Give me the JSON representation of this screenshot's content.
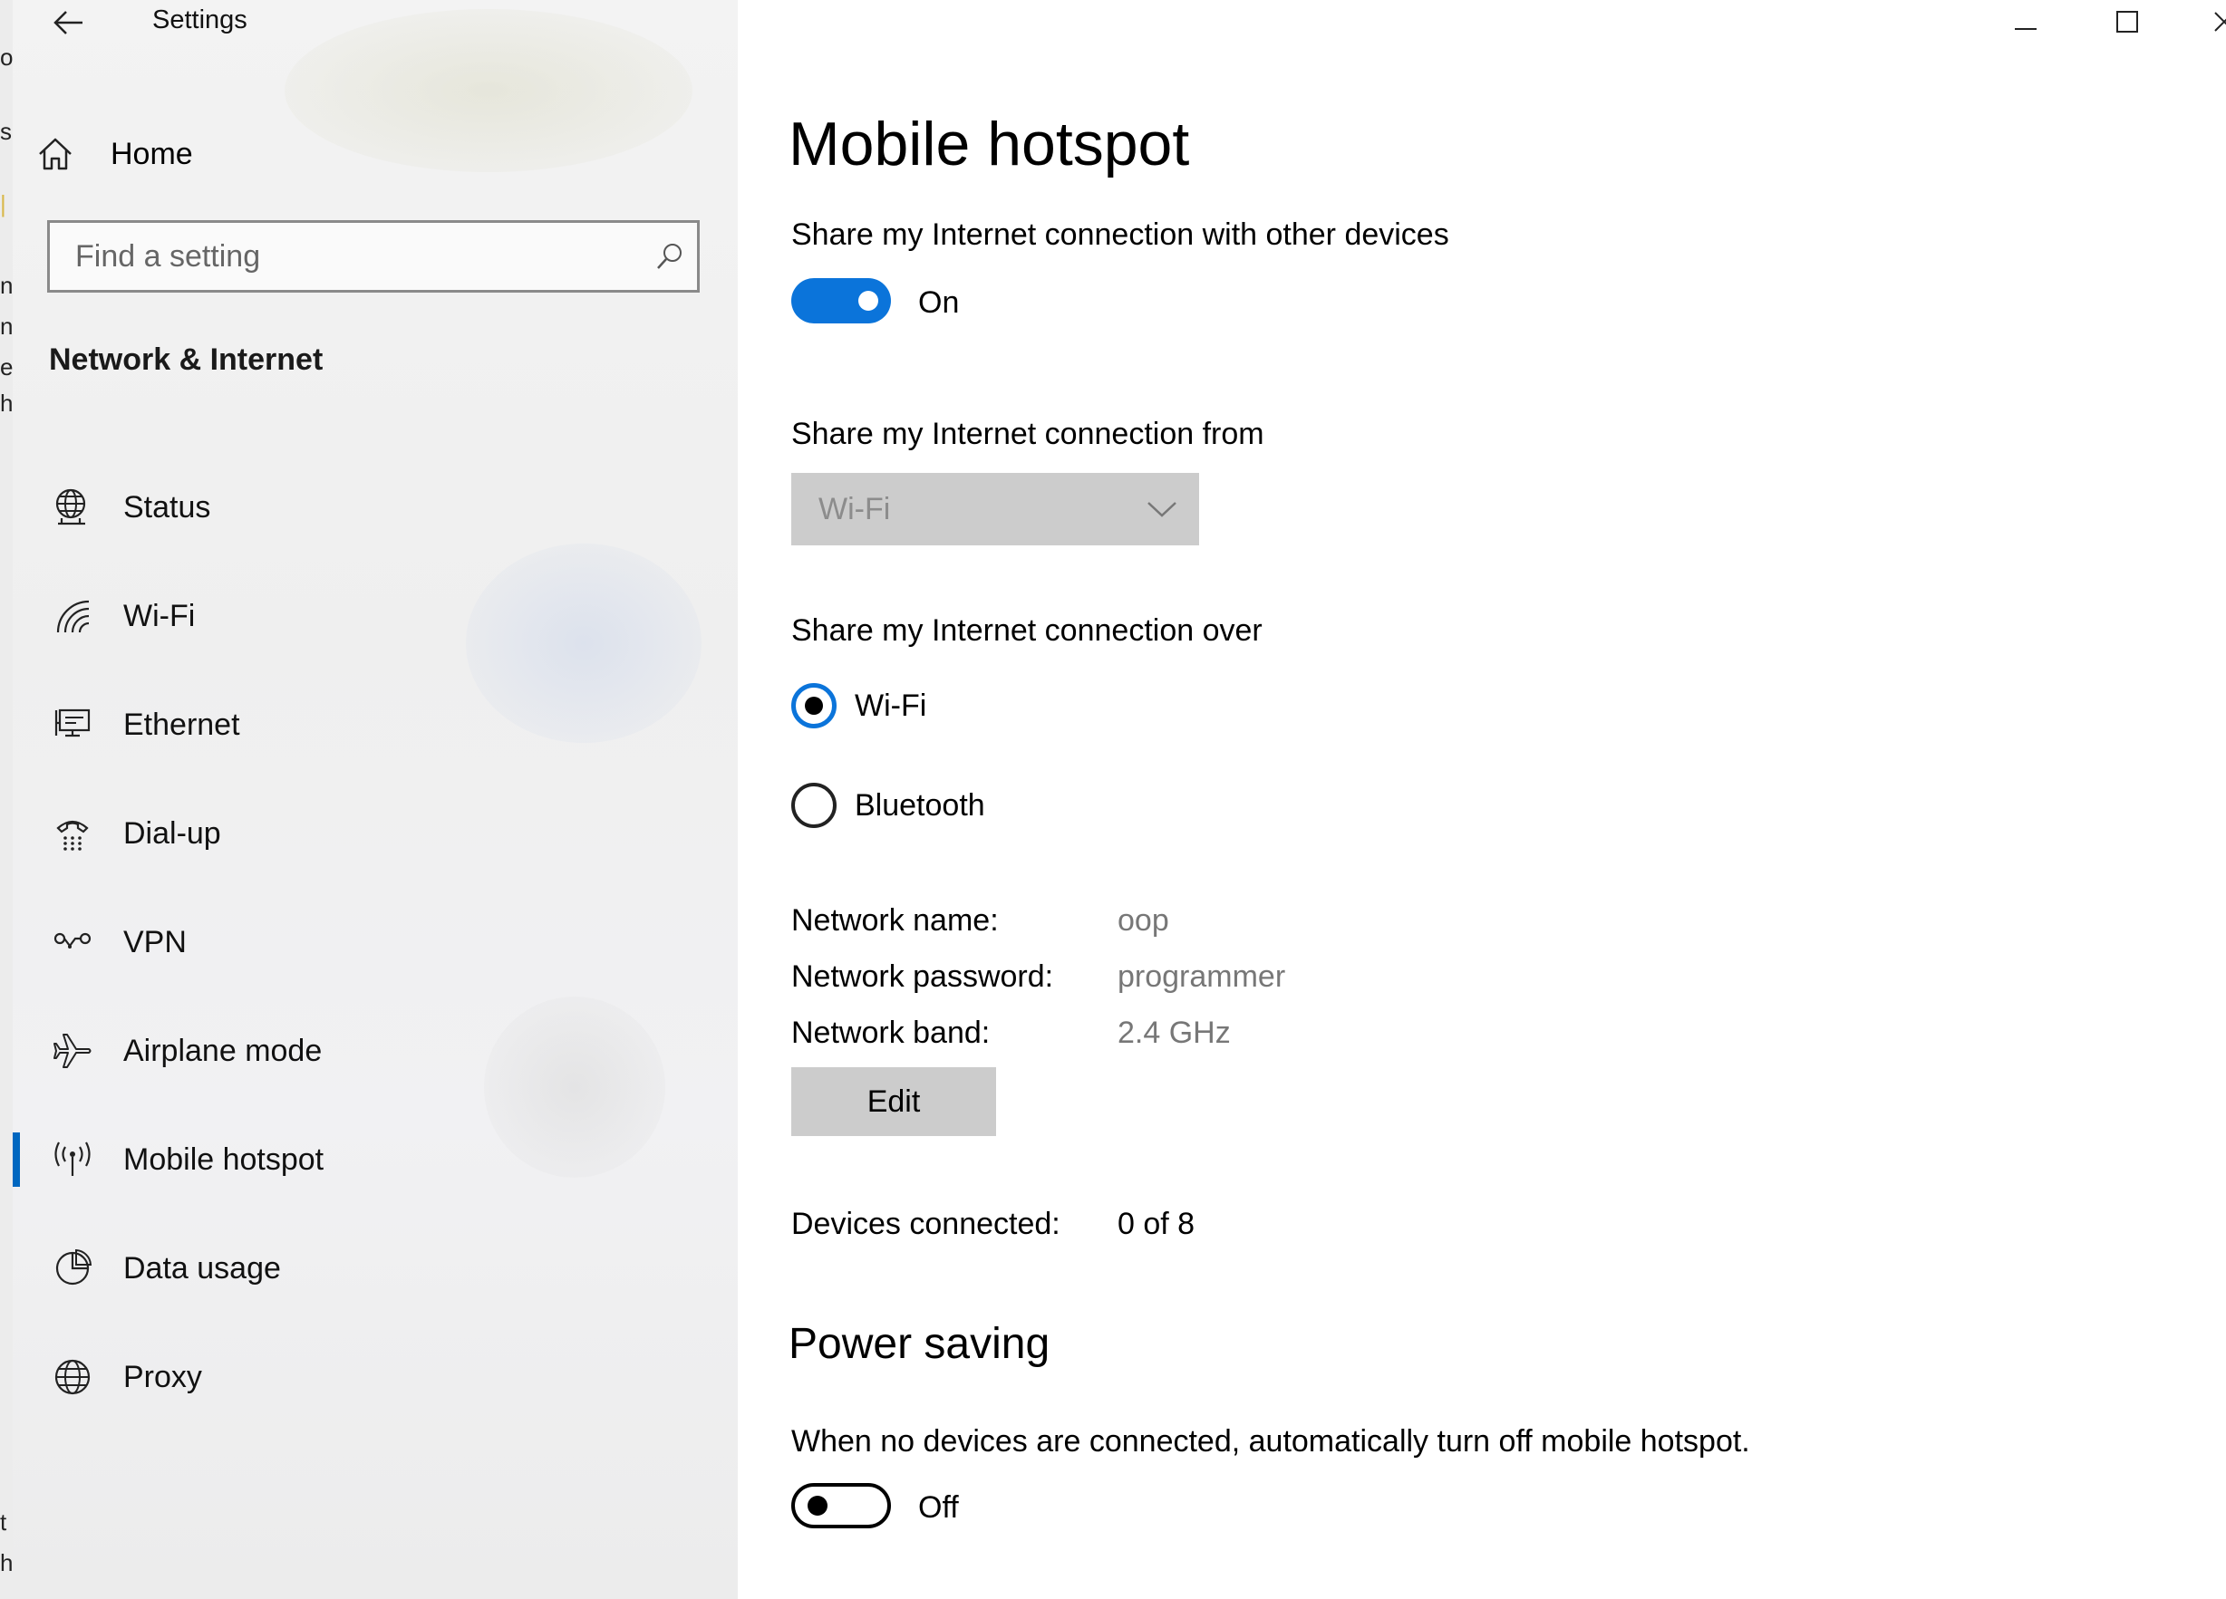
{
  "window": {
    "title": "Settings"
  },
  "sidebar": {
    "home_label": "Home",
    "search_placeholder": "Find a setting",
    "section_title": "Network & Internet",
    "items": [
      {
        "id": "status",
        "label": "Status",
        "icon": "globe-status-icon",
        "selected": false
      },
      {
        "id": "wifi",
        "label": "Wi-Fi",
        "icon": "wifi-icon",
        "selected": false
      },
      {
        "id": "ethernet",
        "label": "Ethernet",
        "icon": "ethernet-icon",
        "selected": false
      },
      {
        "id": "dialup",
        "label": "Dial-up",
        "icon": "dialup-phone-icon",
        "selected": false
      },
      {
        "id": "vpn",
        "label": "VPN",
        "icon": "vpn-icon",
        "selected": false
      },
      {
        "id": "airplane",
        "label": "Airplane mode",
        "icon": "airplane-icon",
        "selected": false
      },
      {
        "id": "hotspot",
        "label": "Mobile hotspot",
        "icon": "hotspot-antenna-icon",
        "selected": true
      },
      {
        "id": "datausage",
        "label": "Data usage",
        "icon": "pie-chart-icon",
        "selected": false
      },
      {
        "id": "proxy",
        "label": "Proxy",
        "icon": "globe-icon",
        "selected": false
      }
    ]
  },
  "main": {
    "title": "Mobile hotspot",
    "share_label": "Share my Internet connection with other devices",
    "share_toggle_state": "On",
    "share_from_label": "Share my Internet connection from",
    "share_from_value": "Wi-Fi",
    "share_over_label": "Share my Internet connection over",
    "share_over_options": [
      {
        "label": "Wi-Fi",
        "checked": true
      },
      {
        "label": "Bluetooth",
        "checked": false
      }
    ],
    "network_info": [
      {
        "key": "Network name:",
        "value": "oop"
      },
      {
        "key": "Network password:",
        "value": "programmer"
      },
      {
        "key": "Network band:",
        "value": "2.4 GHz"
      }
    ],
    "edit_label": "Edit",
    "devices_key": "Devices connected:",
    "devices_value": "0 of 8",
    "power_saving_title": "Power saving",
    "power_saving_desc": "When no devices are connected, automatically turn off mobile hotspot.",
    "power_toggle_state": "Off"
  },
  "colors": {
    "accent": "#0b74da",
    "selection_bar": "#0067c0",
    "button_bg": "#cccccc"
  }
}
